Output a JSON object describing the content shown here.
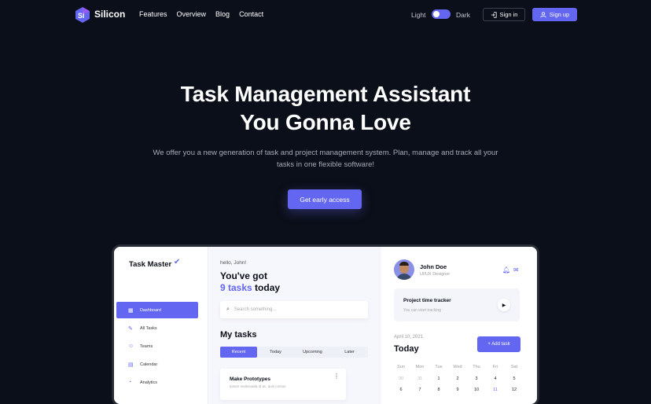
{
  "brand": {
    "logo_letter": "Si",
    "name": "Silicon",
    "accent": "#6366f1",
    "background": "#0b0f19"
  },
  "nav": {
    "links": [
      "Features",
      "Overview",
      "Blog",
      "Contact"
    ],
    "mode_light": "Light",
    "mode_dark": "Dark",
    "sign_in": "Sign in",
    "sign_up": "Sign up"
  },
  "hero": {
    "title_line1": "Task Management Assistant",
    "title_line2": "You Gonna Love",
    "subtitle": "We offer you a new generation of task and project management system. Plan, manage and track all your tasks in one flexible software!",
    "cta": "Get early access"
  },
  "app": {
    "brand": "Task Master",
    "sidebar": [
      {
        "label": "Dashboard",
        "icon": "grid-icon"
      },
      {
        "label": "All Tasks",
        "icon": "edit-icon"
      },
      {
        "label": "Teams",
        "icon": "users-icon"
      },
      {
        "label": "Calendar",
        "icon": "calendar-icon"
      },
      {
        "label": "Analytics",
        "icon": "pie-chart-icon"
      }
    ],
    "greeting": "hello, John!",
    "headline1": "You've got",
    "headline_count": "9 tasks",
    "headline_suffix": "today",
    "search_placeholder": "Search something...",
    "my_tasks": "My tasks",
    "tabs": [
      "Recent",
      "Today",
      "Upcoming",
      "Later"
    ],
    "task": {
      "title": "Make Prototypes",
      "desc": "Ipsum malesuada id ac, quis cursus"
    },
    "user": {
      "name": "John Doe",
      "role": "UI/UX Designer"
    },
    "tracker": {
      "title": "Project time tracker",
      "sub": "You can start tracking"
    },
    "date": "April 10, 2021",
    "today": "Today",
    "add_task": "+ Add task",
    "calendar": {
      "weekdays": [
        "Sun",
        "Mon",
        "Tue",
        "Wed",
        "Thu",
        "Fri",
        "Sat"
      ],
      "rows": [
        [
          "30",
          "31",
          "1",
          "2",
          "3",
          "4",
          "5"
        ],
        [
          "6",
          "7",
          "8",
          "9",
          "10",
          "11",
          "12"
        ]
      ]
    }
  }
}
